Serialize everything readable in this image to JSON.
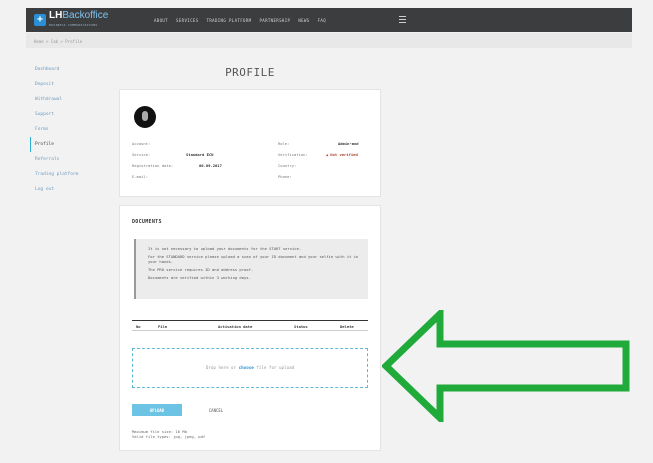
{
  "brand": {
    "mark": "+",
    "name": "LH",
    "name_suffix": "Backoffice",
    "tagline": "BUSINESS COMMUNICATIONS"
  },
  "nav": [
    "ABOUT",
    "SERVICES",
    "TRADING PLATFORM",
    "PARTNERSHIP",
    "NEWS",
    "FAQ"
  ],
  "breadcrumb": "Home > Cab > Profile",
  "sidebar": [
    "Dashboard",
    "Deposit",
    "Withdrawal",
    "Support",
    "Forms",
    "Profile",
    "Referrals",
    "Trading platform",
    "Log out"
  ],
  "active_sidebar_index": 5,
  "page_title": "PROFILE",
  "profile": {
    "account_label": "Account:",
    "service_label": "Service:",
    "service_value": "Standard ECN",
    "registration_label": "Registration date:",
    "registration_value": "06.09.2017",
    "email_label": "E-mail:",
    "role_label": "Role:",
    "role_value": "Admin-mod",
    "verification_label": "Verification:",
    "verification_value": "Not verified",
    "country_label": "Country:",
    "phone_label": "Phone:"
  },
  "documents": {
    "title": "DOCUMENTS",
    "info": [
      "It is not necessary to upload your documents for the START service.",
      "For the STANDARD service please upload a scan of your ID document and your selfie with it in your hands.",
      "The PRO service requires ID and address proof.",
      "Documents are verified within 3 working days."
    ],
    "columns": [
      "No",
      "File",
      "Activation date",
      "Status",
      "Delete"
    ],
    "dropzone_prefix": "Drop here or",
    "dropzone_link": "choose",
    "dropzone_suffix": "file for upload",
    "upload_label": "UPLOAD",
    "cancel_label": "CANCEL",
    "max_size": "Maximum file size: 16 Mb",
    "file_types": "Valid file types: jpg, jpeg, pdf"
  },
  "colors": {
    "arrow": "#1faa3a",
    "accent": "#2fb0d8",
    "topbar": "#3b3d3f"
  }
}
